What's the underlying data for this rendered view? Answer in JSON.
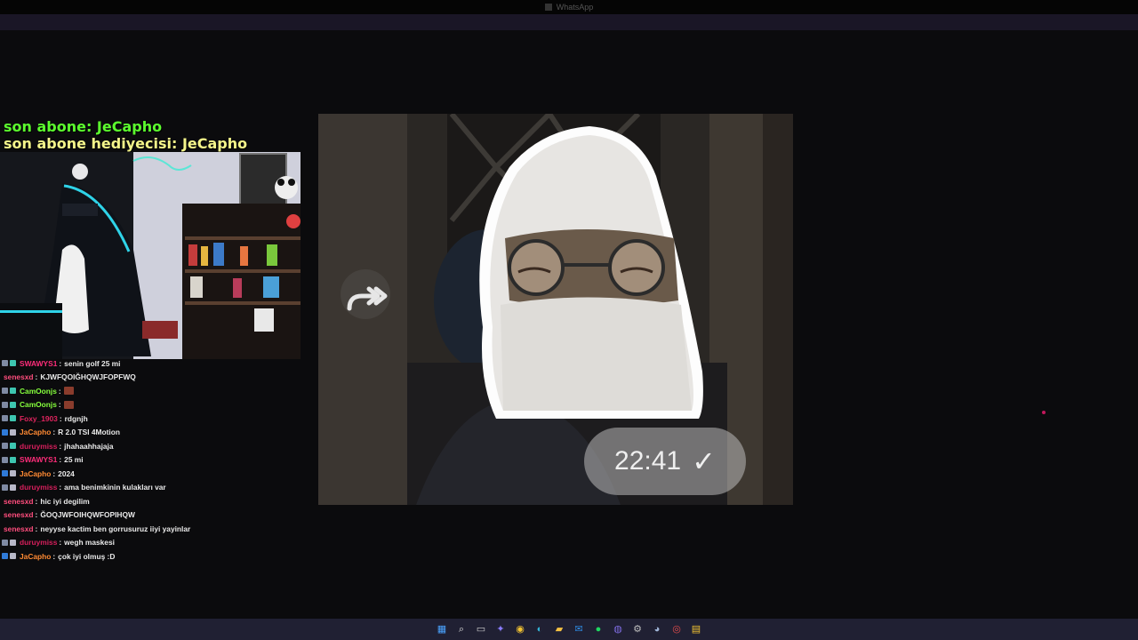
{
  "window": {
    "title": "WhatsApp"
  },
  "overlay": {
    "last_sub": "son abone: JeCapho",
    "last_gifter": "son abone hediyecisi: JeCapho"
  },
  "chat": [
    {
      "user": "SWAWYS1",
      "color": "#ff2d7a",
      "badges": [
        "b-mod",
        "b-sub"
      ],
      "message": "senin golf 25 mi"
    },
    {
      "user": "senesxd",
      "color": "#ff4d7d",
      "badges": [],
      "message": "KJWFQOIĞHQWJFOPFWQ"
    },
    {
      "user": "CamOonjs",
      "color": "#86ff3d",
      "badges": [
        "b-mod",
        "b-sub"
      ],
      "message": "",
      "emote": true
    },
    {
      "user": "CamOonjs",
      "color": "#86ff3d",
      "badges": [
        "b-mod",
        "b-sub"
      ],
      "message": "",
      "emote": true
    },
    {
      "user": "Foxy_1903",
      "color": "#e0245e",
      "badges": [
        "b-mod",
        "b-sub"
      ],
      "message": "rdgnjh"
    },
    {
      "user": "JaCapho",
      "color": "#ff8a33",
      "badges": [
        "b-vip",
        "b-staff"
      ],
      "message": "R 2.0 TSI 4Motion"
    },
    {
      "user": "duruymiss",
      "color": "#d61f5c",
      "badges": [
        "b-mod",
        "b-sub"
      ],
      "message": "jhahaahhajaja"
    },
    {
      "user": "SWAWYS1",
      "color": "#ff2d7a",
      "badges": [
        "b-mod",
        "b-sub"
      ],
      "message": "25 mi"
    },
    {
      "user": "JaCapho",
      "color": "#ff8a33",
      "badges": [
        "b-vip",
        "b-staff"
      ],
      "message": "2024"
    },
    {
      "user": "duruymiss",
      "color": "#d61f5c",
      "badges": [
        "b-mod",
        "b-staff"
      ],
      "message": "ama benimkinin kulakları var"
    },
    {
      "user": "senesxd",
      "color": "#ff4d7d",
      "badges": [],
      "message": "hic iyi degilim"
    },
    {
      "user": "senesxd",
      "color": "#ff4d7d",
      "badges": [],
      "message": "ĞOQJWFOIHQWFOPIHQW"
    },
    {
      "user": "senesxd",
      "color": "#ff4d7d",
      "badges": [],
      "message": "neyyse kactim ben gorrusuruz iiyi yayinlar"
    },
    {
      "user": "duruymiss",
      "color": "#d61f5c",
      "badges": [
        "b-mod",
        "b-staff"
      ],
      "message": "wegh maskesi"
    },
    {
      "user": "JaCapho",
      "color": "#ff8a33",
      "badges": [
        "b-vip",
        "b-staff"
      ],
      "message": "çok iyi olmuş :D"
    }
  ],
  "message": {
    "time": "22:41",
    "status_icon": "check-icon"
  },
  "taskbar": [
    {
      "name": "start-icon",
      "glyph": "▦",
      "color": "#4aa3ff"
    },
    {
      "name": "search-icon",
      "glyph": "⌕",
      "color": "#dddddd"
    },
    {
      "name": "task-view-icon",
      "glyph": "▭",
      "color": "#cfcfcf"
    },
    {
      "name": "copilot-icon",
      "glyph": "✦",
      "color": "#8a7cff"
    },
    {
      "name": "chrome-icon",
      "glyph": "◉",
      "color": "#f1c232"
    },
    {
      "name": "edge-icon",
      "glyph": "◐",
      "color": "#33b6d9"
    },
    {
      "name": "file-explorer-icon",
      "glyph": "▰",
      "color": "#f5c242"
    },
    {
      "name": "outlook-icon",
      "glyph": "✉",
      "color": "#2f8ae0"
    },
    {
      "name": "spotify-icon",
      "glyph": "●",
      "color": "#1ed760"
    },
    {
      "name": "whatsapp-icon",
      "glyph": "◍",
      "color": "#7e6ce0"
    },
    {
      "name": "settings-icon",
      "glyph": "⚙",
      "color": "#bdbdbd"
    },
    {
      "name": "steam-icon",
      "glyph": "◕",
      "color": "#9fb4d6"
    },
    {
      "name": "obs-icon",
      "glyph": "◎",
      "color": "#e24c4c"
    },
    {
      "name": "notepad-icon",
      "glyph": "▤",
      "color": "#f1c232"
    }
  ]
}
